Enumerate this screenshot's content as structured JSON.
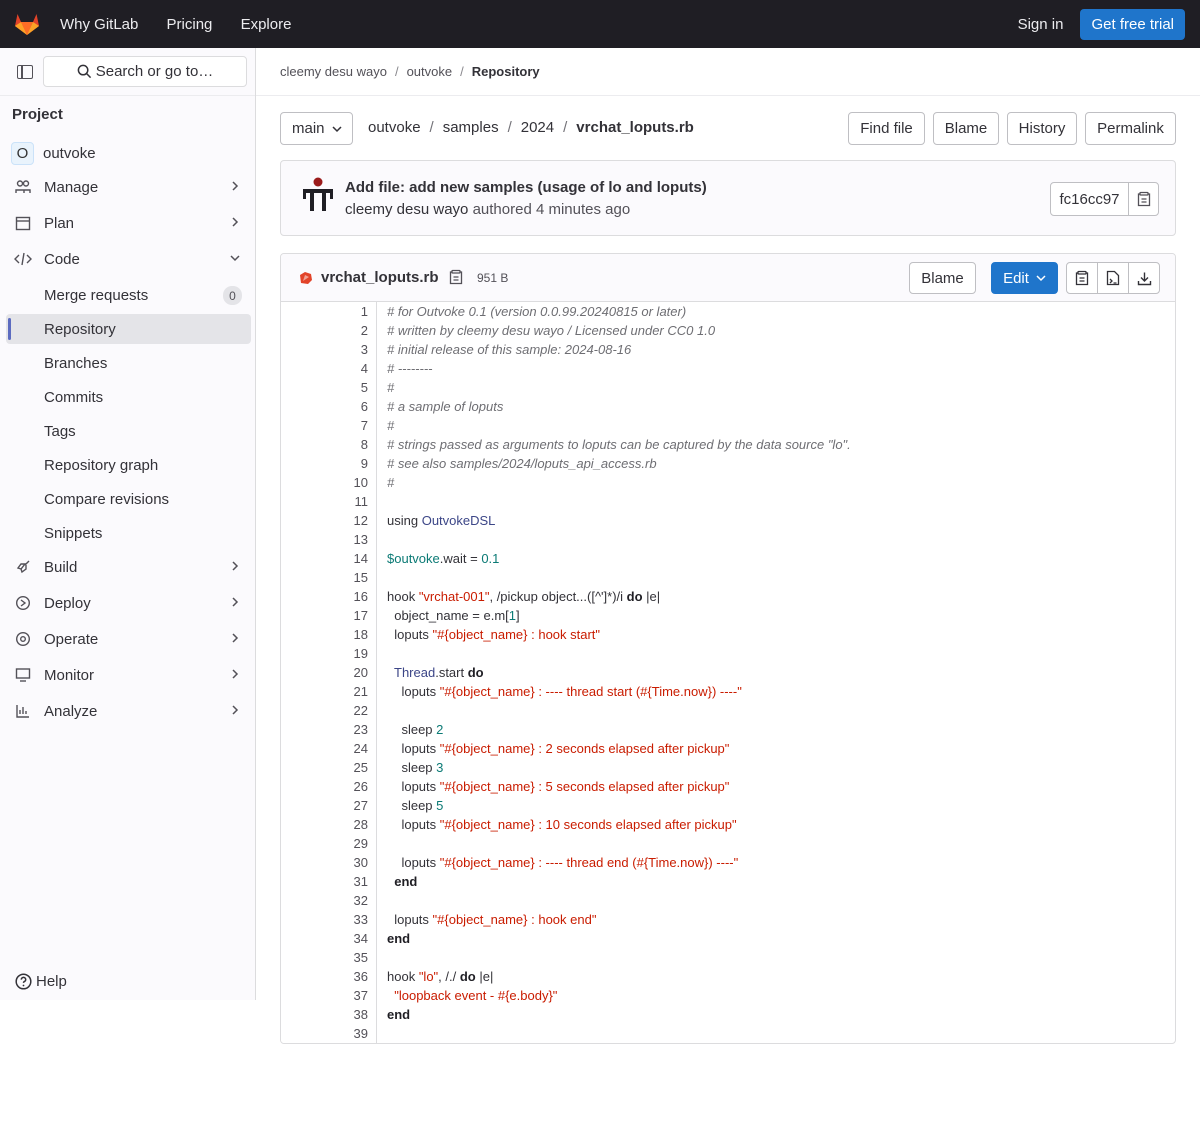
{
  "topbar": {
    "nav": [
      "Why GitLab",
      "Pricing",
      "Explore"
    ],
    "sign_in": "Sign in",
    "trial": "Get free trial"
  },
  "sidebar": {
    "search": "Search or go to…",
    "section_title": "Project",
    "project_initial": "O",
    "project_name": "outvoke",
    "items": [
      {
        "label": "Manage",
        "icon": "users-icon"
      },
      {
        "label": "Plan",
        "icon": "calendar-icon"
      },
      {
        "label": "Code",
        "icon": "code-icon"
      },
      {
        "label": "Build",
        "icon": "rocket-icon"
      },
      {
        "label": "Deploy",
        "icon": "deploy-icon"
      },
      {
        "label": "Operate",
        "icon": "cloud-icon"
      },
      {
        "label": "Monitor",
        "icon": "monitor-icon"
      },
      {
        "label": "Analyze",
        "icon": "chart-icon"
      }
    ],
    "code_sub": [
      "Merge requests",
      "Repository",
      "Branches",
      "Commits",
      "Tags",
      "Repository graph",
      "Compare revisions",
      "Snippets"
    ],
    "merge_count": "0",
    "help": "Help"
  },
  "breadcrumb": [
    "cleemy desu wayo",
    "outvoke",
    "Repository"
  ],
  "repo": {
    "branch": "main",
    "path": [
      "outvoke",
      "samples",
      "2024",
      "vrchat_loputs.rb"
    ],
    "buttons": [
      "Find file",
      "Blame",
      "History",
      "Permalink"
    ]
  },
  "commit": {
    "title": "Add file: add new samples (usage of lo and loputs)",
    "author": "cleemy desu wayo",
    "authored": "authored",
    "time": "4 minutes ago",
    "sha": "fc16cc97"
  },
  "file": {
    "name": "vrchat_loputs.rb",
    "size": "951 B",
    "blame": "Blame",
    "edit": "Edit"
  },
  "code_lines": [
    "# for Outvoke 0.1 (version 0.0.99.20240815 or later)",
    "# written by cleemy desu wayo / Licensed under CC0 1.0",
    "# initial release of this sample: 2024-08-16",
    "# --------",
    "#",
    "# a sample of loputs",
    "#",
    "# strings passed as arguments to loputs can be captured by the data source \"lo\".",
    "# see also samples/2024/loputs_api_access.rb",
    "#",
    "",
    "using OutvokeDSL",
    "",
    "$outvoke.wait = 0.1",
    "",
    "hook \"vrchat-001\", /pickup object...([^']*)/i do |e|",
    "  object_name = e.m[1]",
    "  loputs \"#{object_name} : hook start\"",
    "",
    "  Thread.start do",
    "    loputs \"#{object_name} : ---- thread start (#{Time.now}) ----\"",
    "",
    "    sleep 2",
    "    loputs \"#{object_name} : 2 seconds elapsed after pickup\"",
    "    sleep 3",
    "    loputs \"#{object_name} : 5 seconds elapsed after pickup\"",
    "    sleep 5",
    "    loputs \"#{object_name} : 10 seconds elapsed after pickup\"",
    "",
    "    loputs \"#{object_name} : ---- thread end (#{Time.now}) ----\"",
    "  end",
    "",
    "  loputs \"#{object_name} : hook end\"",
    "end",
    "",
    "hook \"lo\", /./ do |e|",
    "  \"loopback event - #{e.body}\"",
    "end",
    ""
  ]
}
